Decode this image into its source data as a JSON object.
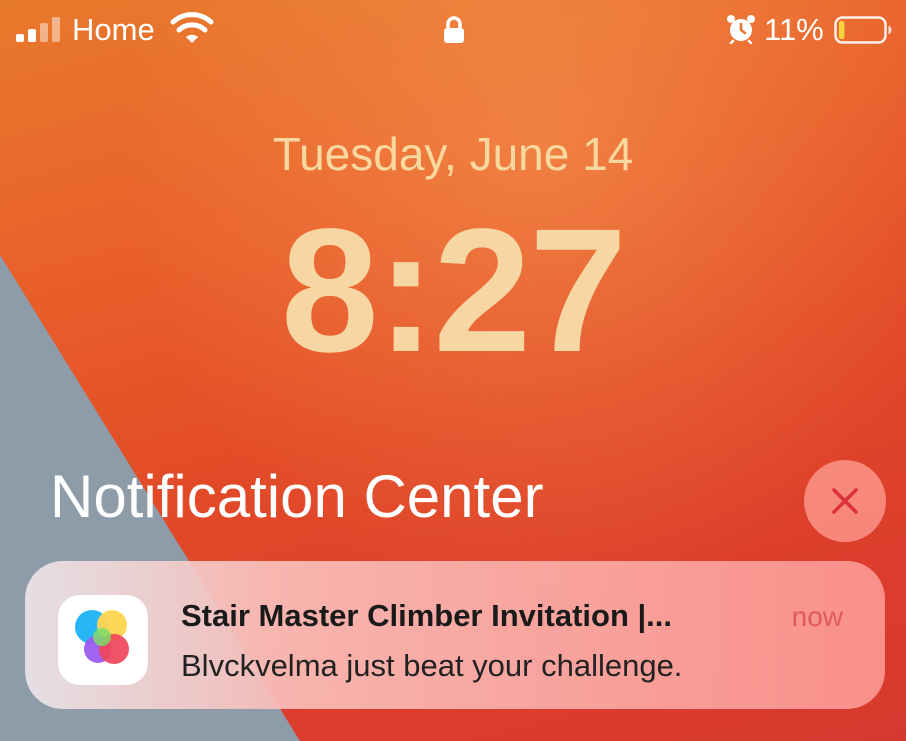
{
  "status_bar": {
    "carrier": "Home",
    "battery_percent": "11%",
    "battery_level": 0.11,
    "signal_bars_filled": 2,
    "signal_bars_total": 4,
    "icons": [
      "signal-icon",
      "wifi-icon",
      "lock-icon",
      "alarm-icon",
      "battery-icon"
    ]
  },
  "lock_screen": {
    "date": "Tuesday, June 14",
    "time": "8:27"
  },
  "notification_center": {
    "title": "Notification Center",
    "clear_icon": "close-icon"
  },
  "notification": {
    "app_icon": "game-center-icon",
    "title": "Stair Master Climber Invitation |...",
    "time": "now",
    "body": "Blvckvelma just beat your challenge."
  },
  "colors": {
    "wallpaper_orange": "#e9612b",
    "wallpaper_gray": "#8e9ba9",
    "clock_text": "#f6d6a2",
    "battery_low": "#f5d33a",
    "notif_time": "#e05a5a"
  }
}
